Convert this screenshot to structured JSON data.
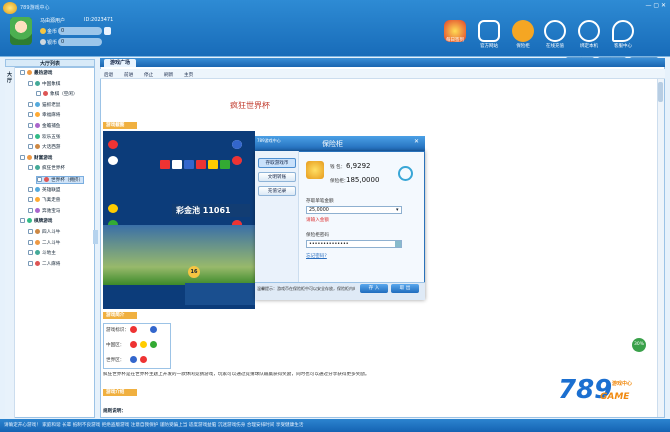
{
  "header": {
    "title": "789游戏中心",
    "nickname": "马由源用户",
    "uid": "ID:2023471"
  },
  "currency": [
    {
      "label": "金币",
      "value": "0"
    },
    {
      "label": "银币",
      "value": "0"
    }
  ],
  "toolbar": [
    {
      "label": "官方网站",
      "icon": "home-icon",
      "color": "#ffffff"
    },
    {
      "label": "保险柜",
      "icon": "coin-icon",
      "color": "#f5a623"
    },
    {
      "label": "在线充值",
      "icon": "recharge-icon",
      "color": "#ffffff"
    },
    {
      "label": "绑定本机",
      "icon": "lock-icon",
      "color": "#ffffff"
    },
    {
      "label": "客服中心",
      "icon": "chat-icon",
      "color": "#ffffff"
    }
  ],
  "promo": "每日签到",
  "right_tabs": [
    "游戏帮助",
    "我的工具",
    "系统设置"
  ],
  "sidebar": {
    "header": "大厅列表",
    "side_label": "大厅",
    "items": [
      {
        "label": "最热游戏",
        "level": 0,
        "bold": true
      },
      {
        "label": "中国象棋",
        "level": 1
      },
      {
        "label": "象棋（空闲）",
        "level": 2
      },
      {
        "label": "猫抓老鼠",
        "level": 1
      },
      {
        "label": "幸福麻将",
        "level": 1
      },
      {
        "label": "金蟾捕鱼",
        "level": 1
      },
      {
        "label": "欢乐五张",
        "level": 1
      },
      {
        "label": "大话西游",
        "level": 1
      },
      {
        "label": "财富游戏",
        "level": 0,
        "bold": true
      },
      {
        "label": "疯狂世界杯",
        "level": 1
      },
      {
        "label": "世界杯（拥挤）",
        "level": 2,
        "selected": true
      },
      {
        "label": "英雄联盟",
        "level": 1
      },
      {
        "label": "飞禽走兽",
        "level": 1
      },
      {
        "label": "奔驰宝马",
        "level": 1
      },
      {
        "label": "棋牌游戏",
        "level": 0,
        "bold": true
      },
      {
        "label": "四人斗牛",
        "level": 1
      },
      {
        "label": "二人斗牛",
        "level": 1
      },
      {
        "label": "斗地主",
        "level": 1
      },
      {
        "label": "二人麻将",
        "level": 1
      }
    ]
  },
  "main": {
    "tab": "游戏广场",
    "tools": [
      "后退",
      "前进",
      "停止",
      "刷新",
      "主页"
    ],
    "heading": "疯狂世界杯",
    "section_screens": "游戏截图",
    "section_data": "游戏简介",
    "section_intro": "游戏介绍",
    "rule_label": "规则说明：",
    "jackpot": "彩金池 11061",
    "game_number": "16",
    "data_rows": [
      "游戏标识：",
      "中国区：",
      "世界区："
    ],
    "description": "疯狂世界杯是在世界杯主题上开发的一款休闲竞猜游戏，玩家可以通过竞猜球队输赢获得奖励，同时也可以通过分享获得更多奖励。"
  },
  "dialog": {
    "app": "789游戏中心",
    "title": "保险柜",
    "tabs": [
      "存取游戏币",
      "文明转账",
      "充值记录"
    ],
    "balance_label": "钱 包：",
    "balance": "6,9292",
    "bank_label": "保险柜：",
    "bank": "185,0000",
    "amount_label": "存取单笔金额",
    "amount": "25,0000",
    "amount_hint": "请输入金额",
    "pwd_label": "保险柜密码",
    "pwd": "••••••••••••••",
    "forgot": "忘记密码?",
    "notice": "温馨提示：游戏币在保险柜中可以安全存放，保险柜内的游戏币不能进行游戏。",
    "deposit": "存 入",
    "withdraw": "取 出"
  },
  "brand": {
    "num": "789",
    "game": "GAME",
    "tag": "游戏中心"
  },
  "online_badge": "30%",
  "status": "请确定开心游戏！ 家庭和谐 长辈 抵制不良游戏 拒绝盗版游戏 注意自我保护 谨防受骗上当 适度游戏益脑 沉迷游戏伤身 合理安排时间 享受健康生活"
}
